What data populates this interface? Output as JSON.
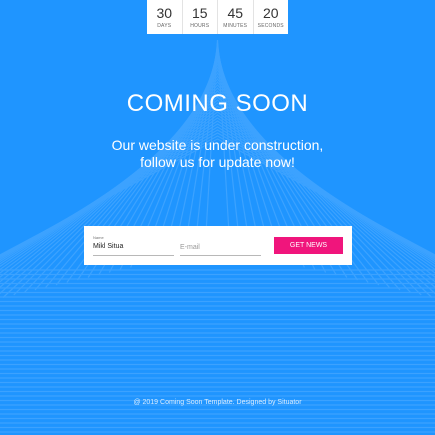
{
  "countdown": [
    {
      "value": "30",
      "label": "DAYS"
    },
    {
      "value": "15",
      "label": "HOURS"
    },
    {
      "value": "45",
      "label": "MINUTES"
    },
    {
      "value": "20",
      "label": "SECONDS"
    }
  ],
  "hero": {
    "title": "COMING SOON",
    "subtitle_line1": "Our website is under construction,",
    "subtitle_line2": "follow us for update now!"
  },
  "form": {
    "name_label": "Name",
    "name_value": "Mikl Situa",
    "email_placeholder": "E-mail",
    "submit_label": "GET NEWS"
  },
  "footer": {
    "text": "@ 2019 Coming Soon Template. Designed by Situator"
  },
  "colors": {
    "background": "#1f95ff",
    "stripe": "#4aa9ff",
    "accent": "#f0157c"
  }
}
